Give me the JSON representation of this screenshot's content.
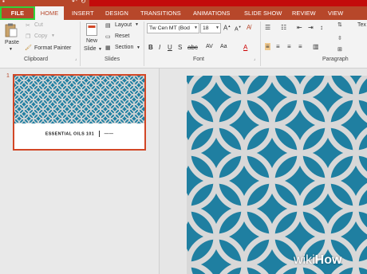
{
  "ribbon_tabs": [
    "FILE",
    "HOME",
    "INSERT",
    "DESIGN",
    "TRANSITIONS",
    "ANIMATIONS",
    "SLIDE SHOW",
    "REVIEW",
    "VIEW"
  ],
  "clipboard": {
    "paste": "Paste",
    "cut": "Cut",
    "copy": "Copy",
    "format_painter": "Format Painter",
    "label": "Clipboard"
  },
  "slides_group": {
    "new_slide_1": "New",
    "new_slide_2": "Slide",
    "layout": "Layout",
    "reset": "Reset",
    "section": "Section",
    "label": "Slides"
  },
  "font_group": {
    "font_name": "Tw Cen MT (Bod",
    "font_size": "18",
    "label": "Font"
  },
  "paragraph_group": {
    "label": "Paragraph",
    "text_direction": "Tex"
  },
  "slide_panel": {
    "slide_number": "1",
    "thumb_caption_left": "ESSENTIAL OILS 101",
    "thumb_caption_right": "——"
  },
  "watermark": {
    "prefix": "wiki",
    "brand": "How"
  },
  "colors": {
    "accent": "#b7472a",
    "file_highlight": "#2fd33a",
    "slide_bg": "#1f7fa1",
    "pattern": "#d8d8d8"
  }
}
